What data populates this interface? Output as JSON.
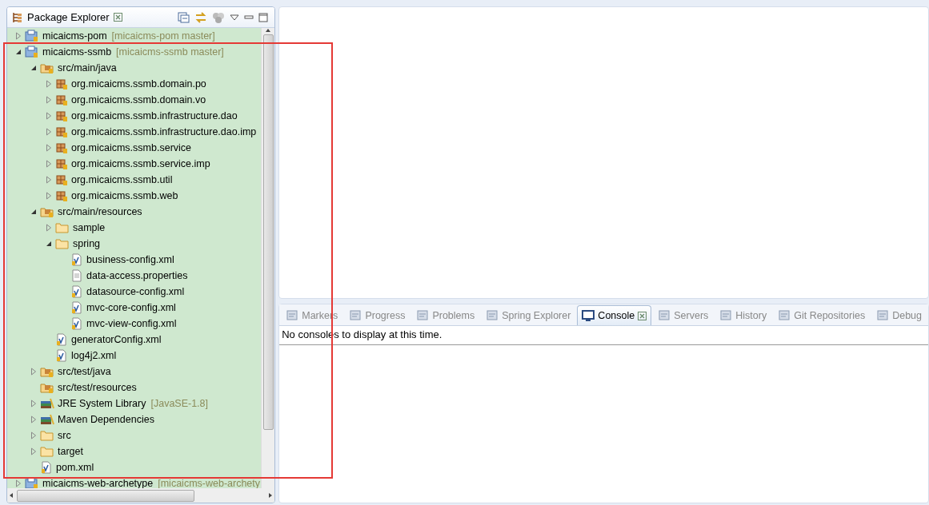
{
  "explorer": {
    "title": "Package Explorer",
    "tree": [
      {
        "name": "micaicms-pom",
        "decoration": "[micaicms-pom master]",
        "kind": "project",
        "expanded": false
      },
      {
        "name": "micaicms-ssmb",
        "decoration": "[micaicms-ssmb master]",
        "kind": "project",
        "expanded": true,
        "children": [
          {
            "name": "src/main/java",
            "kind": "source-folder",
            "expanded": true,
            "children": [
              {
                "name": "org.micaicms.ssmb.domain.po",
                "kind": "package",
                "expanded": false
              },
              {
                "name": "org.micaicms.ssmb.domain.vo",
                "kind": "package",
                "expanded": false
              },
              {
                "name": "org.micaicms.ssmb.infrastructure.dao",
                "kind": "package",
                "expanded": false
              },
              {
                "name": "org.micaicms.ssmb.infrastructure.dao.imp",
                "kind": "package",
                "expanded": false
              },
              {
                "name": "org.micaicms.ssmb.service",
                "kind": "package",
                "expanded": false
              },
              {
                "name": "org.micaicms.ssmb.service.imp",
                "kind": "package",
                "expanded": false
              },
              {
                "name": "org.micaicms.ssmb.util",
                "kind": "package",
                "expanded": false
              },
              {
                "name": "org.micaicms.ssmb.web",
                "kind": "package",
                "expanded": false
              }
            ]
          },
          {
            "name": "src/main/resources",
            "kind": "source-folder",
            "expanded": true,
            "children": [
              {
                "name": "sample",
                "kind": "folder",
                "expanded": false
              },
              {
                "name": "spring",
                "kind": "folder",
                "expanded": true,
                "children": [
                  {
                    "name": "business-config.xml",
                    "kind": "xml"
                  },
                  {
                    "name": "data-access.properties",
                    "kind": "properties"
                  },
                  {
                    "name": "datasource-config.xml",
                    "kind": "xml"
                  },
                  {
                    "name": "mvc-core-config.xml",
                    "kind": "xml"
                  },
                  {
                    "name": "mvc-view-config.xml",
                    "kind": "xml"
                  }
                ]
              },
              {
                "name": "generatorConfig.xml",
                "kind": "xml"
              },
              {
                "name": "log4j2.xml",
                "kind": "xml"
              }
            ]
          },
          {
            "name": "src/test/java",
            "kind": "source-folder",
            "expanded": false
          },
          {
            "name": "src/test/resources",
            "kind": "source-folder"
          },
          {
            "name": "JRE System Library",
            "decoration": "[JavaSE-1.8]",
            "kind": "library",
            "expanded": false
          },
          {
            "name": "Maven Dependencies",
            "kind": "library",
            "expanded": false
          },
          {
            "name": "src",
            "kind": "folder",
            "expanded": false
          },
          {
            "name": "target",
            "kind": "folder",
            "expanded": false
          },
          {
            "name": "pom.xml",
            "kind": "xml"
          }
        ]
      },
      {
        "name": "micaicms-web-archetype",
        "decoration": "[micaicms-web-archety",
        "kind": "project",
        "expanded": false
      }
    ]
  },
  "bottom_panel": {
    "tabs": [
      {
        "label": "Markers",
        "selected": false
      },
      {
        "label": "Progress",
        "selected": false
      },
      {
        "label": "Problems",
        "selected": false
      },
      {
        "label": "Spring Explorer",
        "selected": false
      },
      {
        "label": "Console",
        "selected": true
      },
      {
        "label": "Servers",
        "selected": false
      },
      {
        "label": "History",
        "selected": false
      },
      {
        "label": "Git Repositories",
        "selected": false
      },
      {
        "label": "Debug",
        "selected": false
      }
    ],
    "message": "No consoles to display at this time."
  }
}
